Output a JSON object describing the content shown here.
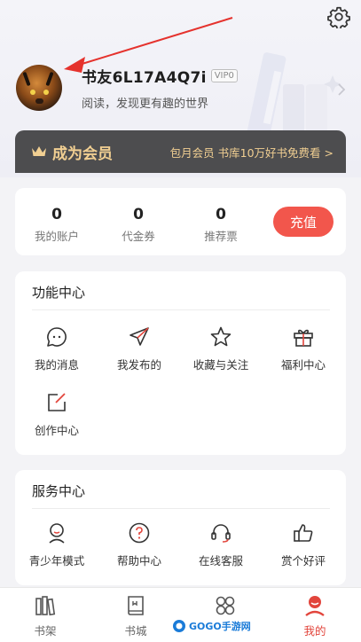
{
  "profile": {
    "username": "书友6L17A4Q7i",
    "vip_badge": "VIP0",
    "slogan": "阅读，发现更有趣的世界"
  },
  "member": {
    "title": "成为会员",
    "promo": "包月会员 书库10万好书免费看 >"
  },
  "account": {
    "stats": [
      {
        "value": "0",
        "label": "我的账户"
      },
      {
        "value": "0",
        "label": "代金券"
      },
      {
        "value": "0",
        "label": "推荐票"
      }
    ],
    "recharge_label": "充值"
  },
  "functions": {
    "title": "功能中心",
    "items": [
      {
        "label": "我的消息",
        "icon": "message-icon"
      },
      {
        "label": "我发布的",
        "icon": "paper-plane-icon"
      },
      {
        "label": "收藏与关注",
        "icon": "star-icon"
      },
      {
        "label": "福利中心",
        "icon": "gift-icon"
      },
      {
        "label": "创作中心",
        "icon": "edit-icon"
      }
    ]
  },
  "services": {
    "title": "服务中心",
    "items": [
      {
        "label": "青少年模式",
        "icon": "child-icon"
      },
      {
        "label": "帮助中心",
        "icon": "help-icon"
      },
      {
        "label": "在线客服",
        "icon": "headset-icon"
      },
      {
        "label": "赏个好评",
        "icon": "thumbs-up-icon"
      }
    ]
  },
  "tabbar": {
    "items": [
      {
        "label": "书架",
        "icon": "bookshelf-icon",
        "active": false
      },
      {
        "label": "书城",
        "icon": "book-icon",
        "active": false
      },
      {
        "label": "",
        "icon": "grid-icon",
        "active": false
      },
      {
        "label": "我的",
        "icon": "user-icon",
        "active": true
      }
    ]
  },
  "watermark": {
    "text": "GOGO手游网"
  },
  "colors": {
    "accent": "#f2564c",
    "gold": "#f1cf92",
    "member_bg": "#4d4d4f",
    "active_tab": "#e2453c"
  }
}
